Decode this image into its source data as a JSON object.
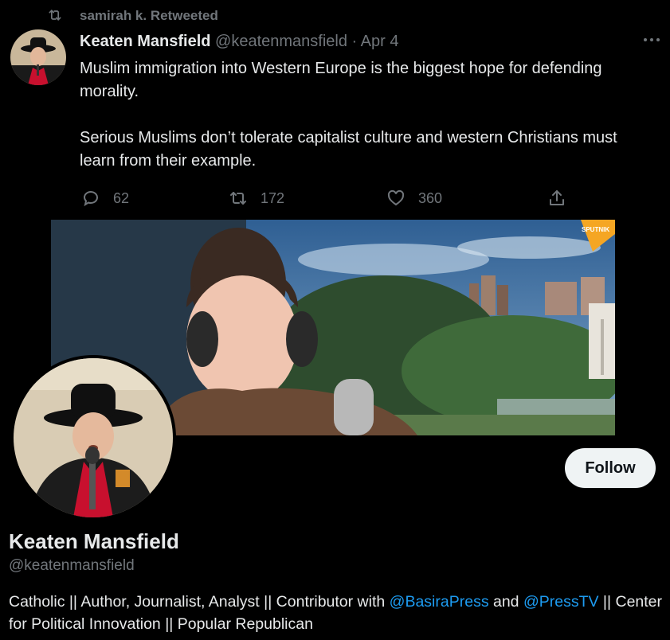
{
  "retweet_header": {
    "text": "samirah k. Retweeted",
    "icon": "retweet-icon"
  },
  "tweet": {
    "author_name": "Keaten Mansfield",
    "author_handle": "@keatenmansfield",
    "separator": " · ",
    "date": "Apr 4",
    "more_icon": "more-icon",
    "paragraphs": [
      "Muslim immigration into Western Europe is the biggest hope for defending morality.",
      "Serious Muslims don’t tolerate capitalist culture and western Christians must learn from their example."
    ],
    "actions": {
      "reply_count": "62",
      "retweet_count": "172",
      "like_count": "360"
    }
  },
  "banner": {
    "watermark": "SPUTNIK"
  },
  "profile": {
    "follow_label": "Follow",
    "name": "Keaten Mansfield",
    "handle": "@keatenmansfield",
    "bio": {
      "part1": "Catholic || Author, Journalist, Analyst || Contributor with ",
      "mention1": "@BasiraPress",
      "part2": " and ",
      "mention2": "@PressTV",
      "part3": " || Center for Political Innovation || Popular Republican"
    }
  },
  "colors": {
    "background": "#000000",
    "text": "#e7e9ea",
    "muted": "#71767b",
    "link": "#1d9bf0",
    "follow_bg": "#eff3f4"
  }
}
